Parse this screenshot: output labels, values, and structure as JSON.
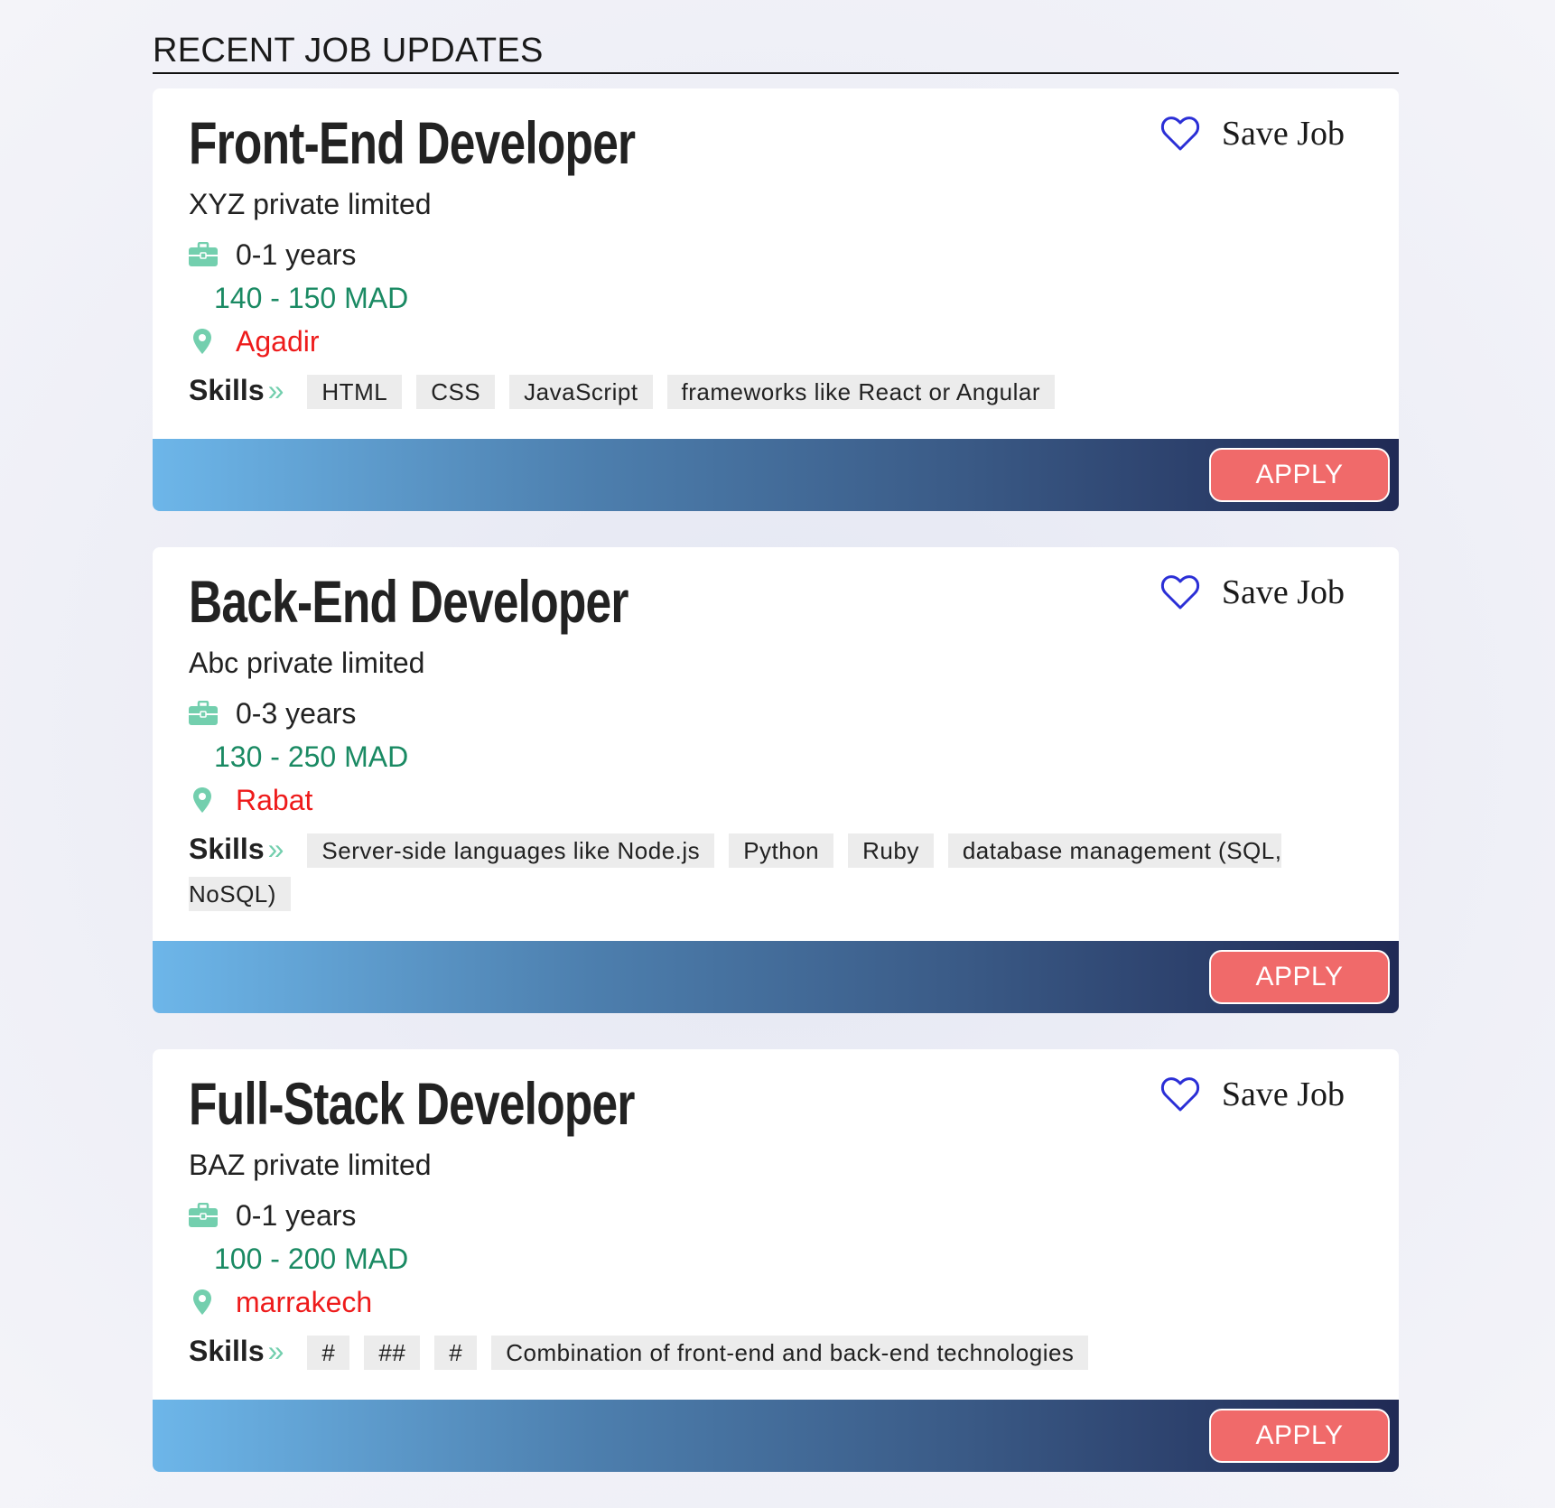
{
  "section": {
    "title": "RECENT JOB UPDATES"
  },
  "colors": {
    "accent_green": "#1a8a63",
    "icon_teal": "#73cfae",
    "location_red": "#ee1b1b",
    "apply_button": "#f06a6a",
    "heart_blue": "#2b2fd6"
  },
  "jobs": [
    {
      "title": "Front-End Developer",
      "company": "XYZ private limited",
      "experience": "0-1 years",
      "salary": "140 - 150 MAD",
      "location": "Agadir",
      "skills_label": "Skills",
      "skills": [
        "HTML",
        "CSS",
        "JavaScript",
        "frameworks like React or Angular"
      ],
      "save_label": "Save Job",
      "apply_label": "APPLY"
    },
    {
      "title": "Back-End Developer",
      "company": "Abc private limited",
      "experience": "0-3 years",
      "salary": "130 - 250 MAD",
      "location": "Rabat",
      "skills_label": "Skills",
      "skills": [
        "Server-side languages like Node.js",
        "Python",
        "Ruby",
        "database management (SQL, NoSQL)"
      ],
      "save_label": "Save Job",
      "apply_label": "APPLY"
    },
    {
      "title": "Full-Stack Developer",
      "company": "BAZ private limited",
      "experience": "0-1 years",
      "salary": "100 - 200 MAD",
      "location": "marrakech",
      "skills_label": "Skills",
      "skills": [
        "#",
        "##",
        "#",
        "Combination of front-end and back-end technologies"
      ],
      "save_label": "Save Job",
      "apply_label": "APPLY"
    }
  ]
}
